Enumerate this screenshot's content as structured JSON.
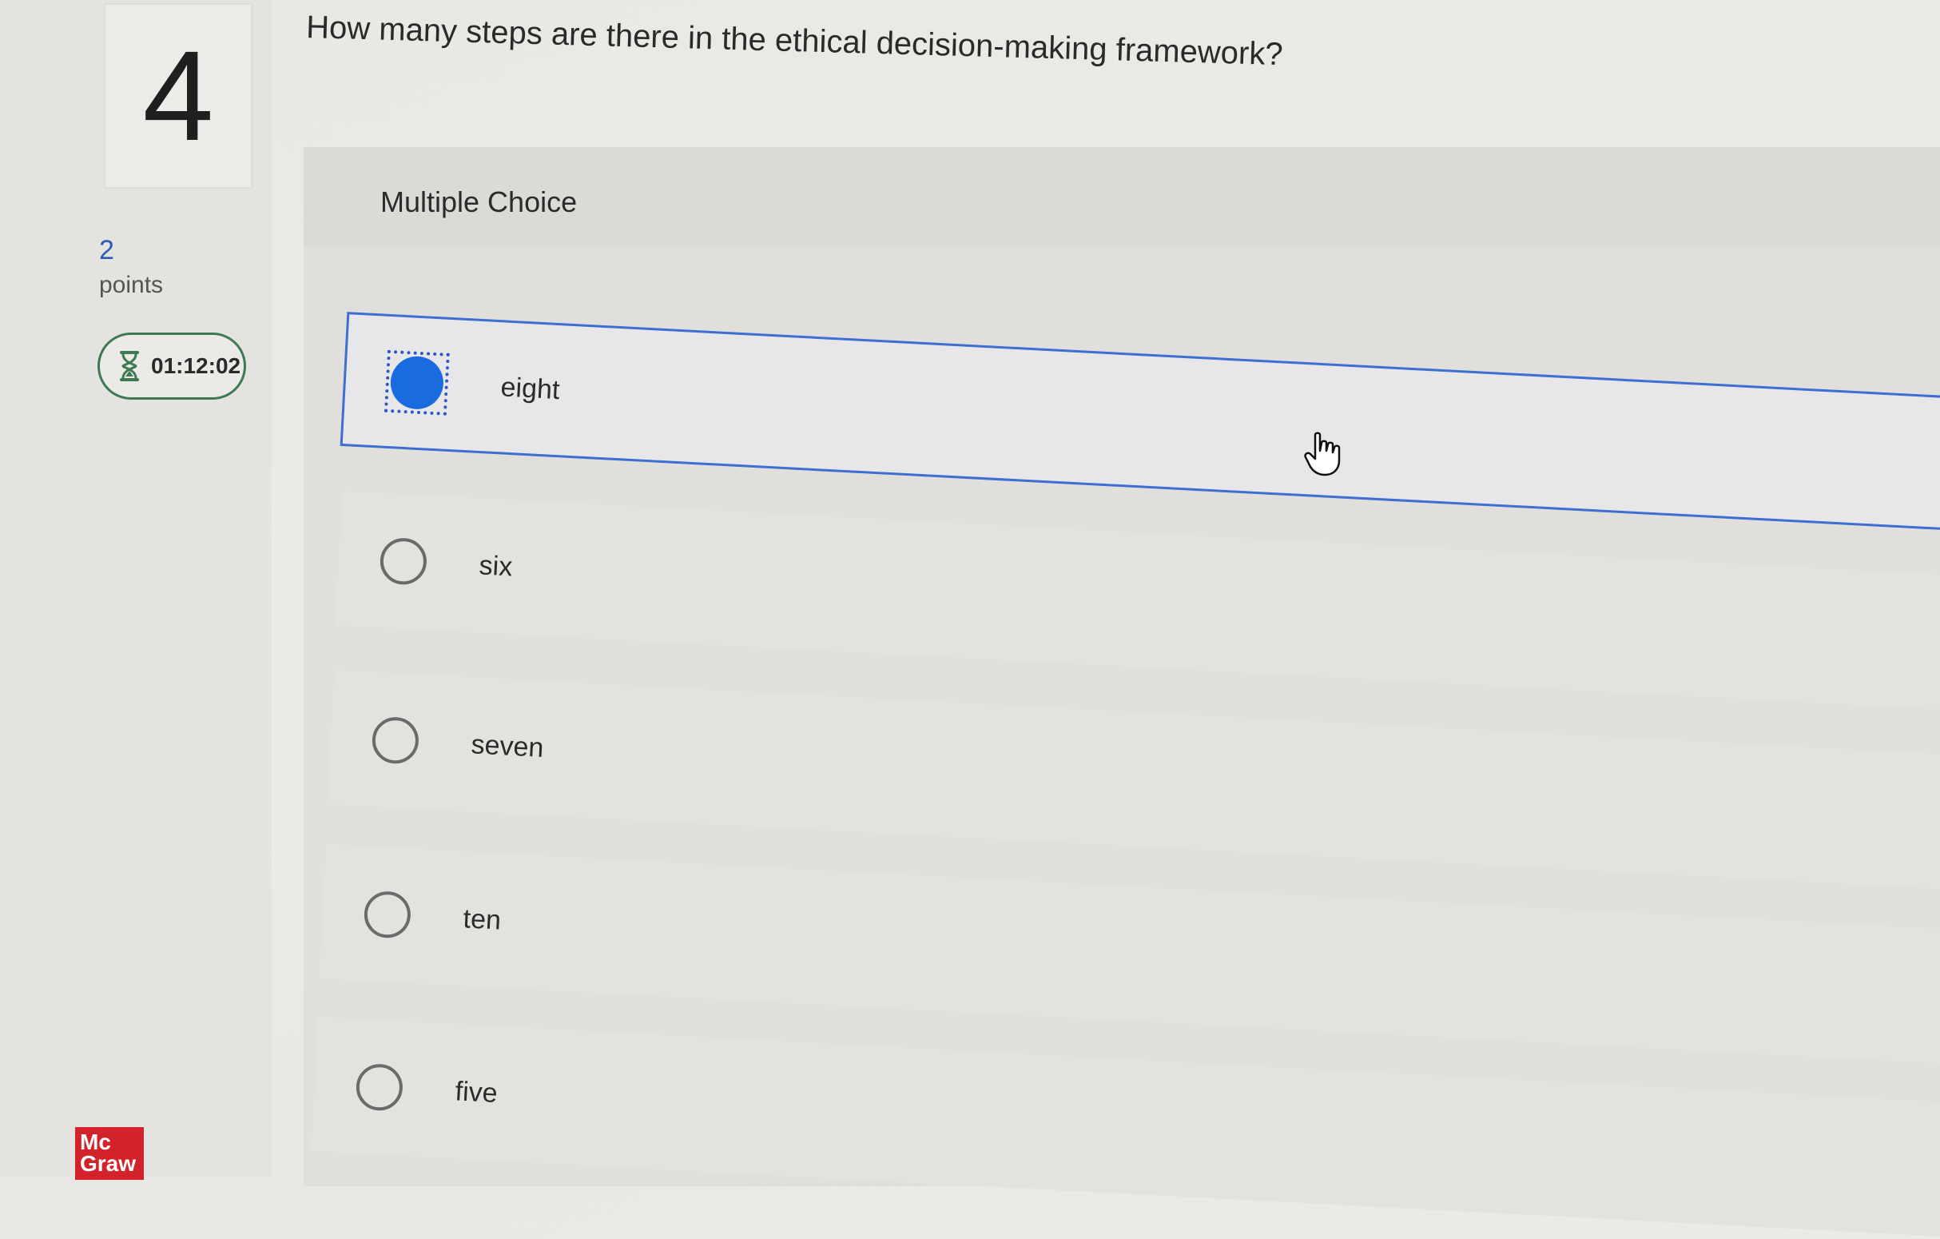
{
  "question": {
    "number": "4",
    "text": "How many steps are there in the ethical decision-making framework?",
    "points_value": "2",
    "points_label": "points",
    "timer": "01:12:02",
    "type_label": "Multiple Choice"
  },
  "options": [
    {
      "label": "eight",
      "selected": true
    },
    {
      "label": "six",
      "selected": false
    },
    {
      "label": "seven",
      "selected": false
    },
    {
      "label": "ten",
      "selected": false
    },
    {
      "label": "five",
      "selected": false
    }
  ],
  "branding": {
    "logo_text_line1": "Mc",
    "logo_text_line2": "Graw",
    "logo_color": "#d2232a"
  },
  "colors": {
    "accent": "#1a6be0",
    "timer_border": "#3c7a54"
  },
  "icons": {
    "timer": "hourglass-icon",
    "cursor": "hand-pointer-icon"
  }
}
